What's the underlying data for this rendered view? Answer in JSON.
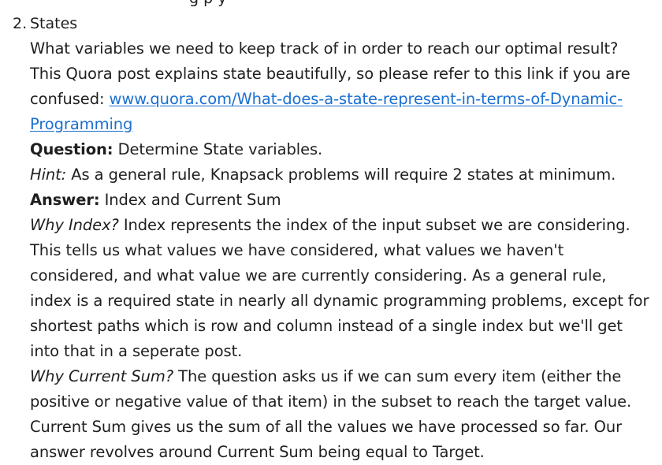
{
  "clipped_text": "g         p   y",
  "item": {
    "number": "2.",
    "title": "States"
  },
  "intro": {
    "text1": "What variables we need to keep track of in order to reach our optimal result? This Quora post explains state beautifully, so please refer to this link if you are confused: ",
    "link_text_1": "www.quora.com/What-does-a-state-represent-in-terms-of-Dynamic-",
    "link_text_2": "Programming"
  },
  "question": {
    "label": "Question:",
    "text": " Determine State variables."
  },
  "hint": {
    "label": "Hint:",
    "text": " As a general rule, Knapsack problems will require 2 states at minimum."
  },
  "answer": {
    "label": "Answer:",
    "text": " Index and Current Sum"
  },
  "why_index": {
    "label": "Why Index?",
    "text": " Index represents the index of the input subset we are considering. This tells us what values we have considered, what values we haven't considered, and what value we are currently considering. As a general rule, index is a required state in nearly all dynamic programming problems, except for shortest paths which is row and column instead of a single index but we'll get into that in a seperate post."
  },
  "why_sum": {
    "label": "Why Current Sum?",
    "text": " The question asks us if we can sum every item (either the positive or negative value of that item) in the subset to reach the target value. Current Sum gives us the sum of all the values we have processed so far. Our answer revolves around Current Sum being equal to Target."
  }
}
